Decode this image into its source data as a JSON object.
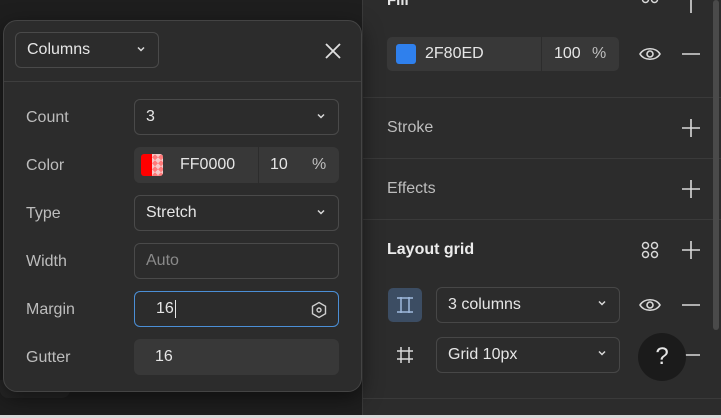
{
  "right_panel": {
    "fill": {
      "title": "Fill",
      "color_hex": "2F80ED",
      "swatch_color": "#2F80ED",
      "opacity": "100",
      "percent_sign": "%"
    },
    "stroke_label": "Stroke",
    "effects_label": "Effects",
    "layout_grid": {
      "title": "Layout grid",
      "rows": [
        {
          "label": "3 columns",
          "icon": "columns-grid-icon",
          "active": true
        },
        {
          "label": "Grid 10px",
          "icon": "grid-icon",
          "active": false
        }
      ]
    },
    "help_label": "?"
  },
  "popup": {
    "type_select": "Columns",
    "fields": {
      "count": {
        "label": "Count",
        "value": "3"
      },
      "color": {
        "label": "Color",
        "hex": "FF0000",
        "opacity": "10",
        "percent_sign": "%"
      },
      "type": {
        "label": "Type",
        "value": "Stretch"
      },
      "width": {
        "label": "Width",
        "placeholder": "Auto"
      },
      "margin": {
        "label": "Margin",
        "value": "16"
      },
      "gutter": {
        "label": "Gutter",
        "value": "16"
      }
    }
  },
  "colors": {
    "accent": "#4B8FD6",
    "fill_swatch": "#2F80ED",
    "grid_color": "#FF0000"
  }
}
